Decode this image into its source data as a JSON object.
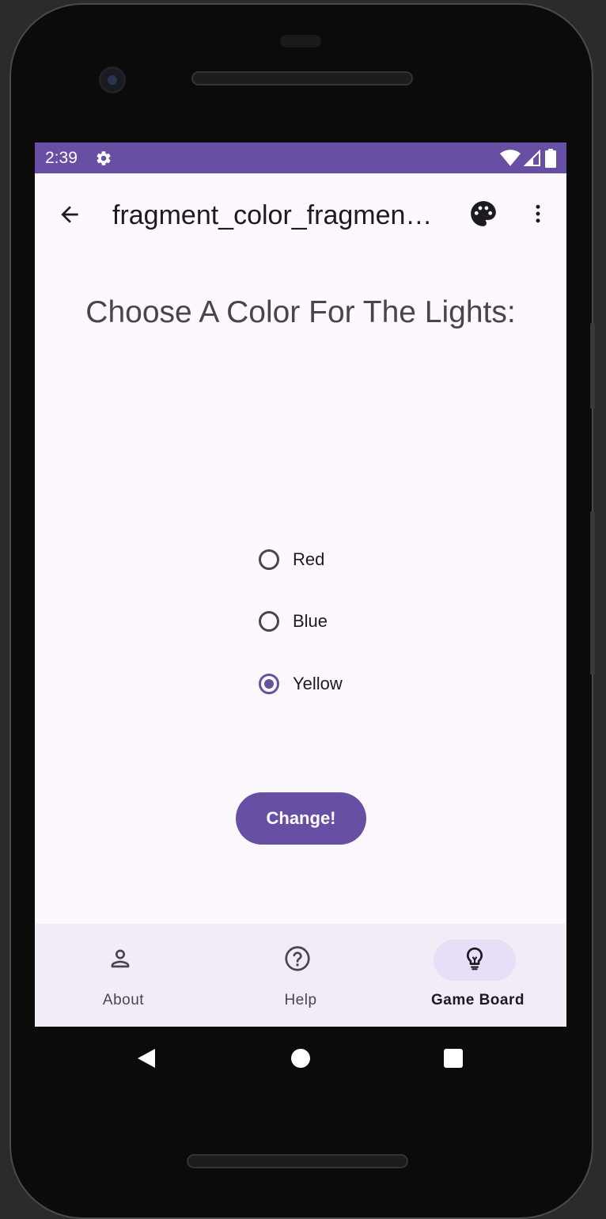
{
  "status_bar": {
    "time": "2:39",
    "icons": [
      "settings-icon",
      "wifi-icon",
      "signal-icon",
      "battery-icon"
    ],
    "color": "#6750a4"
  },
  "app_bar": {
    "title": "fragment_color_fragmen…",
    "icons": [
      "back-arrow-icon",
      "palette-icon",
      "more-vert-icon"
    ]
  },
  "content": {
    "heading": "Choose A Color For The Lights:",
    "radio_options": [
      {
        "label": "Red",
        "selected": false
      },
      {
        "label": "Blue",
        "selected": false
      },
      {
        "label": "Yellow",
        "selected": true
      }
    ],
    "button_label": "Change!"
  },
  "bottom_nav": {
    "items": [
      {
        "label": "About",
        "icon": "person-icon",
        "active": false
      },
      {
        "label": "Help",
        "icon": "help-circle-icon",
        "active": false
      },
      {
        "label": "Game Board",
        "icon": "lightbulb-icon",
        "active": true
      }
    ]
  },
  "system_nav": {
    "icons": [
      "nav-back-icon",
      "nav-home-icon",
      "nav-recents-icon"
    ]
  },
  "colors": {
    "primary": "#6750a4",
    "surface": "#fdf8fd",
    "nav_surface": "#f1ecf5",
    "nav_indicator": "#e8def8"
  }
}
